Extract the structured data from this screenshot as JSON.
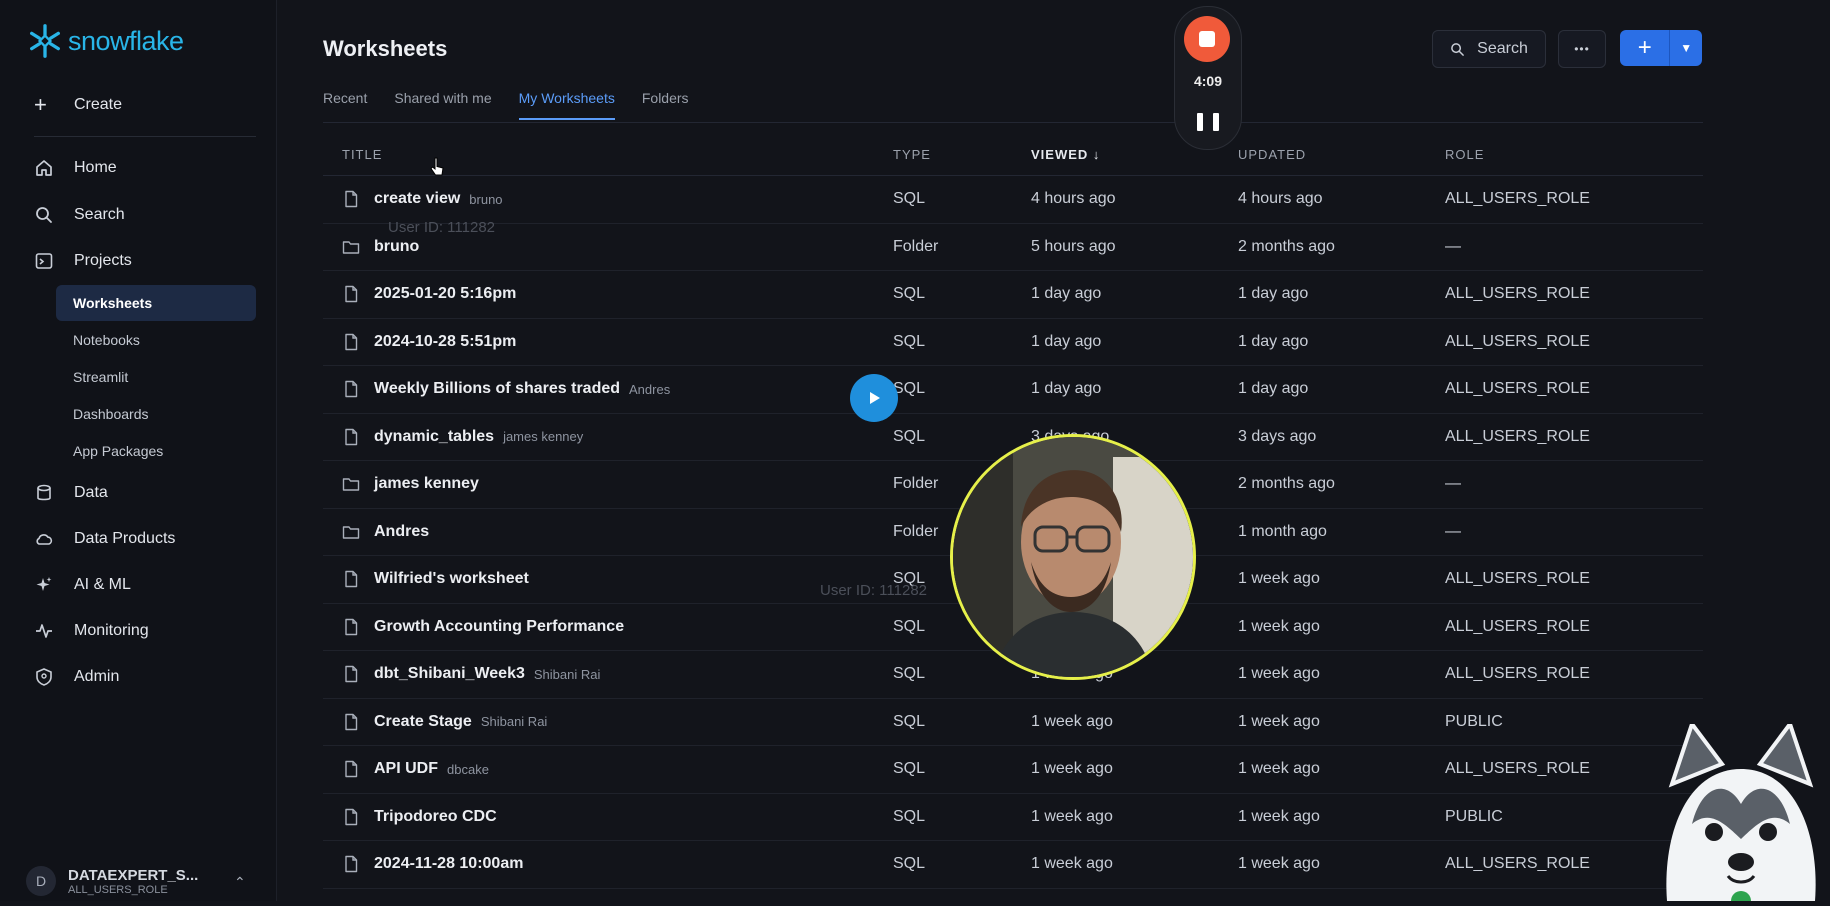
{
  "sidebar": {
    "logo_text": "snowflake",
    "create_label": "Create",
    "nav": [
      {
        "label": "Home",
        "icon": "home-icon"
      },
      {
        "label": "Search",
        "icon": "search-icon"
      },
      {
        "label": "Projects",
        "icon": "projects-icon"
      }
    ],
    "sub_items": [
      "Worksheets",
      "Notebooks",
      "Streamlit",
      "Dashboards",
      "App Packages"
    ],
    "nav2": [
      {
        "label": "Data",
        "icon": "database-icon"
      },
      {
        "label": "Data Products",
        "icon": "cloud-icon"
      },
      {
        "label": "AI & ML",
        "icon": "sparkle-icon"
      },
      {
        "label": "Monitoring",
        "icon": "activity-icon"
      },
      {
        "label": "Admin",
        "icon": "shield-icon"
      }
    ],
    "account": {
      "initial": "D",
      "name": "DATAEXPERT_S...",
      "role": "ALL_USERS_ROLE"
    }
  },
  "header": {
    "title": "Worksheets",
    "search_label": "Search",
    "more_label": "•••",
    "add_label": "+"
  },
  "tabs": [
    "Recent",
    "Shared with me",
    "My Worksheets",
    "Folders"
  ],
  "active_tab": "My Worksheets",
  "table": {
    "columns": [
      "TITLE",
      "TYPE",
      "VIEWED",
      "UPDATED",
      "ROLE"
    ],
    "sorted_column": "VIEWED",
    "rows": [
      {
        "title": "create view",
        "owner": "bruno",
        "kind": "file",
        "type": "SQL",
        "viewed": "4 hours ago",
        "updated": "4 hours ago",
        "role": "ALL_USERS_ROLE"
      },
      {
        "title": "bruno",
        "owner": "",
        "kind": "folder",
        "type": "Folder",
        "viewed": "5 hours ago",
        "updated": "2 months ago",
        "role": "—"
      },
      {
        "title": "2025-01-20 5:16pm",
        "owner": "",
        "kind": "file",
        "type": "SQL",
        "viewed": "1 day ago",
        "updated": "1 day ago",
        "role": "ALL_USERS_ROLE"
      },
      {
        "title": "2024-10-28 5:51pm",
        "owner": "",
        "kind": "file",
        "type": "SQL",
        "viewed": "1 day ago",
        "updated": "1 day ago",
        "role": "ALL_USERS_ROLE"
      },
      {
        "title": "Weekly Billions of shares traded",
        "owner": "Andres",
        "kind": "file",
        "type": "SQL",
        "viewed": "1 day ago",
        "updated": "1 day ago",
        "role": "ALL_USERS_ROLE"
      },
      {
        "title": "dynamic_tables",
        "owner": "james kenney",
        "kind": "file",
        "type": "SQL",
        "viewed": "3 days ago",
        "updated": "3 days ago",
        "role": "ALL_USERS_ROLE"
      },
      {
        "title": "james kenney",
        "owner": "",
        "kind": "folder",
        "type": "Folder",
        "viewed": "",
        "updated": "2 months ago",
        "role": "—"
      },
      {
        "title": "Andres",
        "owner": "",
        "kind": "folder",
        "type": "Folder",
        "viewed": "",
        "updated": "1 month ago",
        "role": "—"
      },
      {
        "title": "Wilfried's worksheet",
        "owner": "",
        "kind": "file",
        "type": "SQL",
        "viewed": "",
        "updated": "1 week ago",
        "role": "ALL_USERS_ROLE"
      },
      {
        "title": "Growth Accounting Performance",
        "owner": "",
        "kind": "file",
        "type": "SQL",
        "viewed": "",
        "updated": "1 week ago",
        "role": "ALL_USERS_ROLE"
      },
      {
        "title": "dbt_Shibani_Week3",
        "owner": "Shibani Rai",
        "kind": "file",
        "type": "SQL",
        "viewed": "1 week ago",
        "updated": "1 week ago",
        "role": "ALL_USERS_ROLE"
      },
      {
        "title": "Create Stage",
        "owner": "Shibani Rai",
        "kind": "file",
        "type": "SQL",
        "viewed": "1 week ago",
        "updated": "1 week ago",
        "role": "PUBLIC"
      },
      {
        "title": "API UDF",
        "owner": "dbcake",
        "kind": "file",
        "type": "SQL",
        "viewed": "1 week ago",
        "updated": "1 week ago",
        "role": "ALL_USERS_ROLE"
      },
      {
        "title": "Tripodoreo CDC",
        "owner": "",
        "kind": "file",
        "type": "SQL",
        "viewed": "1 week ago",
        "updated": "1 week ago",
        "role": "PUBLIC"
      },
      {
        "title": "2024-11-28 10:00am",
        "owner": "",
        "kind": "file",
        "type": "SQL",
        "viewed": "1 week ago",
        "updated": "1 week ago",
        "role": "ALL_USERS_ROLE"
      }
    ]
  },
  "recorder": {
    "time": "4:09"
  },
  "watermark": "User ID: 111282",
  "colors": {
    "accent": "#2b6fe6",
    "brand": "#29b5e8",
    "record": "#f05a3a",
    "camera_ring": "#e6f04a"
  }
}
